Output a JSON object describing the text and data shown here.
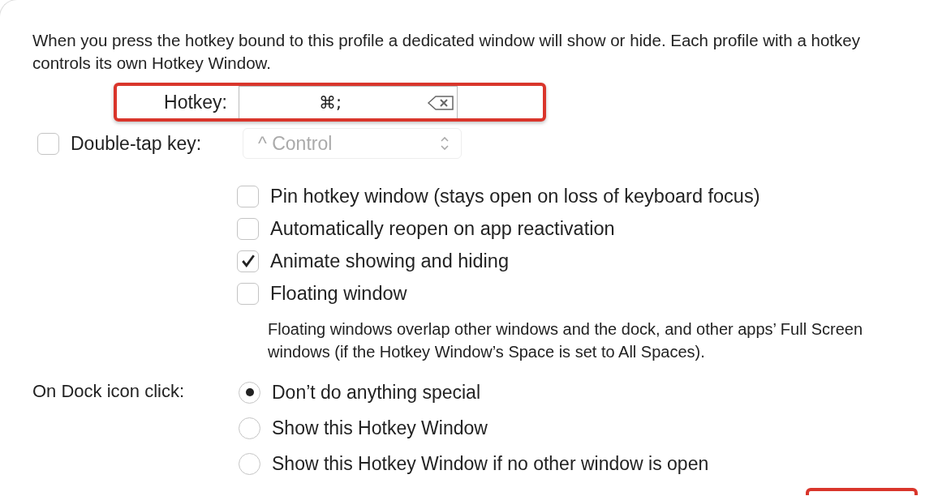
{
  "description": "When you press the hotkey bound to this profile a dedicated window will show or hide. Each profile with a hotkey controls its own Hotkey Window.",
  "hotkey": {
    "label": "Hotkey:",
    "value": "⌘;",
    "highlighted": true
  },
  "double_tap": {
    "label": "Double-tap key:",
    "checked": false,
    "popup": {
      "value": "^ Control",
      "disabled": true
    }
  },
  "options": [
    {
      "label": "Pin hotkey window (stays open on loss of keyboard focus)",
      "checked": false
    },
    {
      "label": "Automatically reopen on app reactivation",
      "checked": false
    },
    {
      "label": "Animate showing and hiding",
      "checked": true
    },
    {
      "label": "Floating window",
      "checked": false
    }
  ],
  "floating_note": "Floating windows overlap other windows and the dock, and other apps’ Full Screen windows (if the Hotkey Window’s Space is set to All Spaces).",
  "dock_click": {
    "label": "On Dock icon click:",
    "choices": [
      {
        "label": "Don’t do anything special",
        "selected": true
      },
      {
        "label": "Show this Hotkey Window",
        "selected": false
      },
      {
        "label": "Show this Hotkey Window if no other window is open",
        "selected": false
      }
    ]
  }
}
